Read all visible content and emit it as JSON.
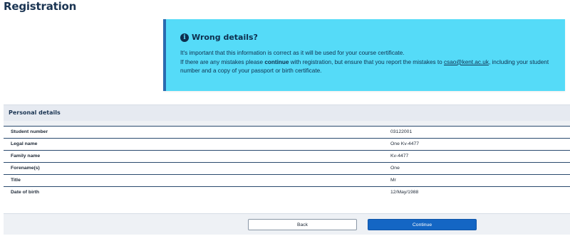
{
  "page": {
    "title": "Registration"
  },
  "alert": {
    "title": "Wrong details?",
    "line1": "It's important that this information is correct as it will be used for your course certificate.",
    "line2_prefix": "If there are any mistakes please ",
    "line2_bold": "continue",
    "line2_mid": " with registration, but ensure that you report the mistakes to ",
    "email": "csao@kent.ac.uk",
    "line2_suffix": ", including your student number and a copy of your passport or birth certificate."
  },
  "personal_details": {
    "heading": "Personal details",
    "rows": [
      {
        "label": "Student number",
        "value": "03122001"
      },
      {
        "label": "Legal name",
        "value": "One Kv-4477"
      },
      {
        "label": "Family name",
        "value": "Kv-4477"
      },
      {
        "label": "Forename(s)",
        "value": "One"
      },
      {
        "label": "Title",
        "value": "Mr"
      },
      {
        "label": "Date of birth",
        "value": "12/May/1988"
      }
    ]
  },
  "actions": {
    "back_label": "Back",
    "continue_label": "Continue"
  },
  "colors": {
    "alert_bg": "#55dbf8",
    "primary": "#1466c4",
    "heading": "#1b3553"
  }
}
